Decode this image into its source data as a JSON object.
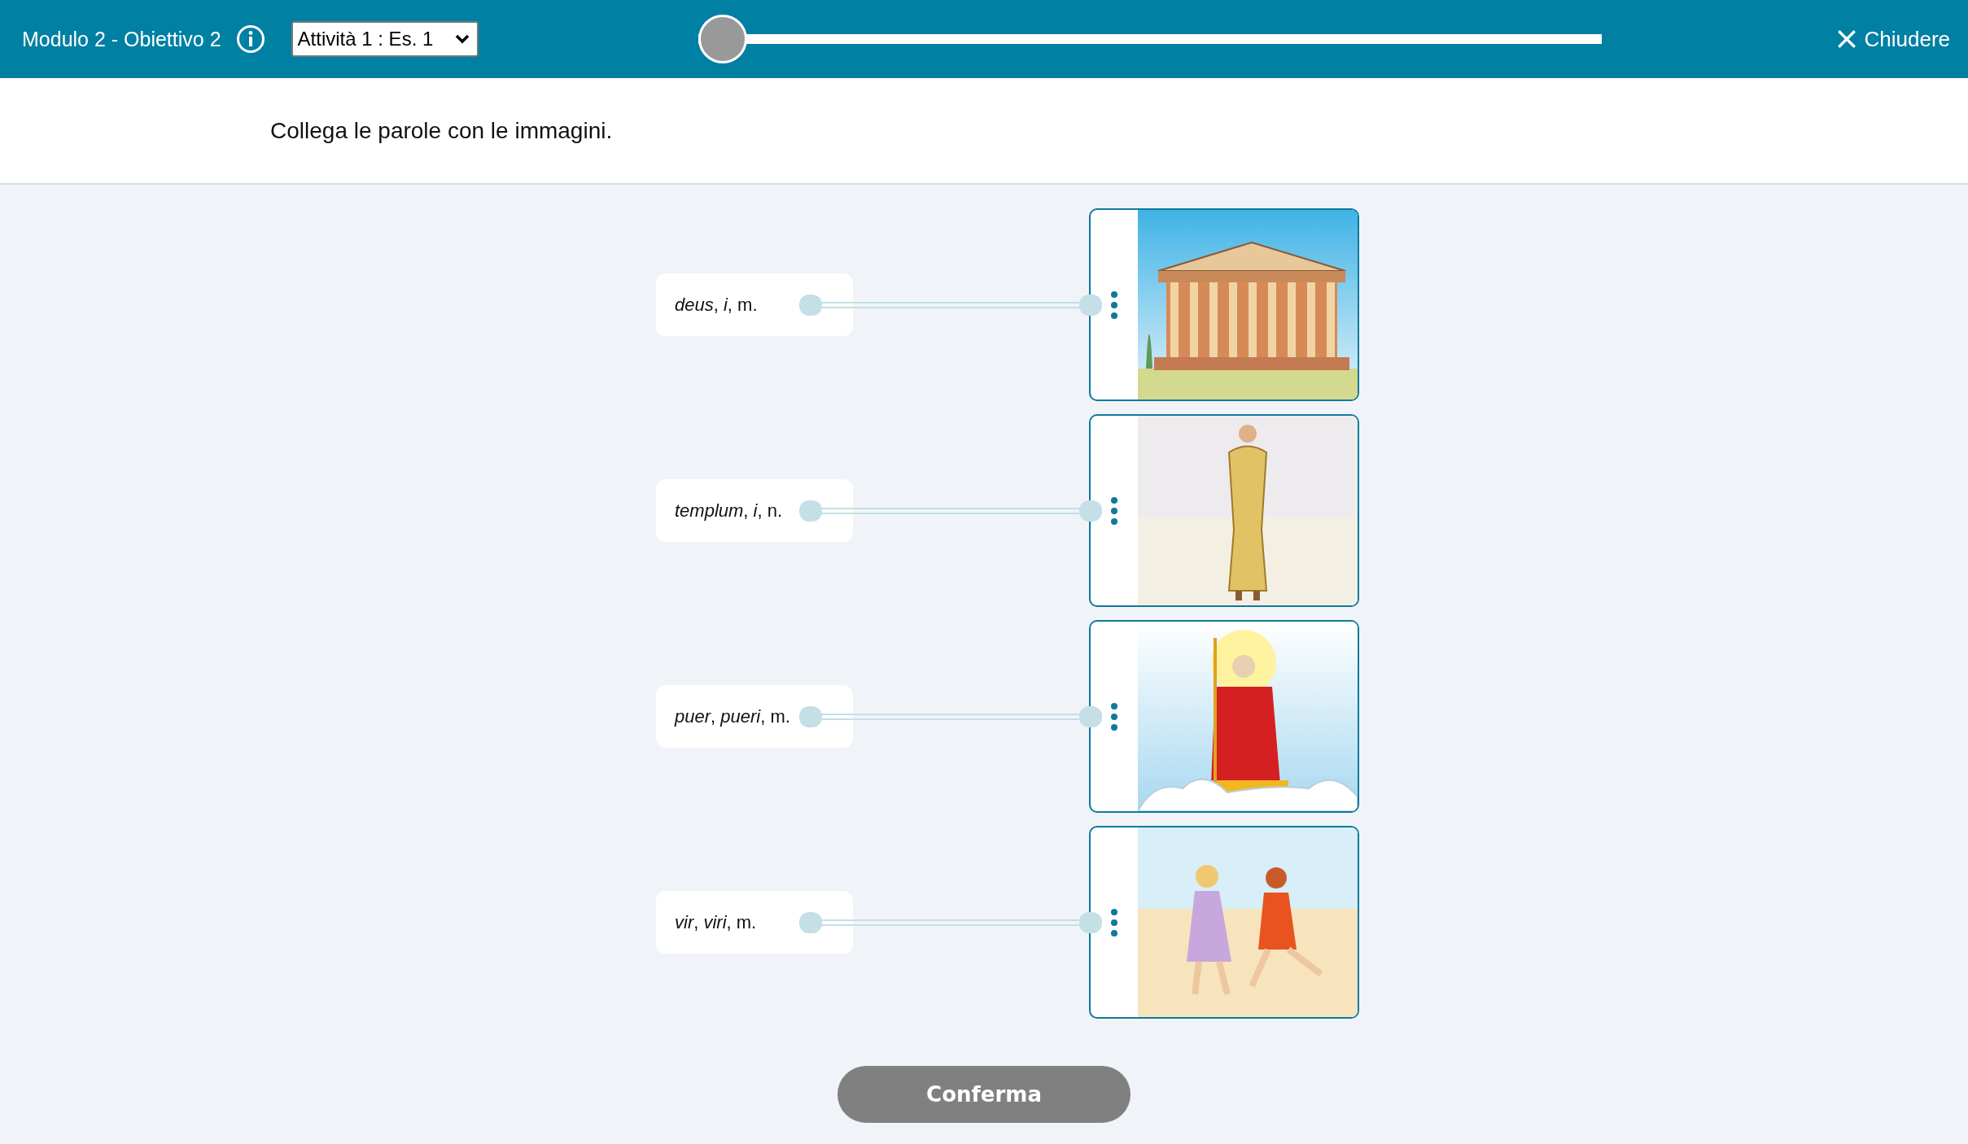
{
  "header": {
    "title": "Modulo 2 - Obiettivo 2",
    "activity_select": {
      "value": "Attività 1 : Es. 1"
    },
    "progress": {
      "level": 0
    },
    "close": {
      "label": "Chiudere"
    }
  },
  "instruction": "Collega le parole con le immagini.",
  "pairs": [
    {
      "word": "*deus*, *i*, m.",
      "kind": "temple"
    },
    {
      "word": "*templum*, *i*, n.",
      "kind": "standing"
    },
    {
      "word": "*puer*, *pueri*, m.",
      "kind": "seated"
    },
    {
      "word": "*vir*, *viri*, m.",
      "kind": "running"
    }
  ],
  "confirm_button": {
    "label": "Conferma",
    "disabled": true
  }
}
